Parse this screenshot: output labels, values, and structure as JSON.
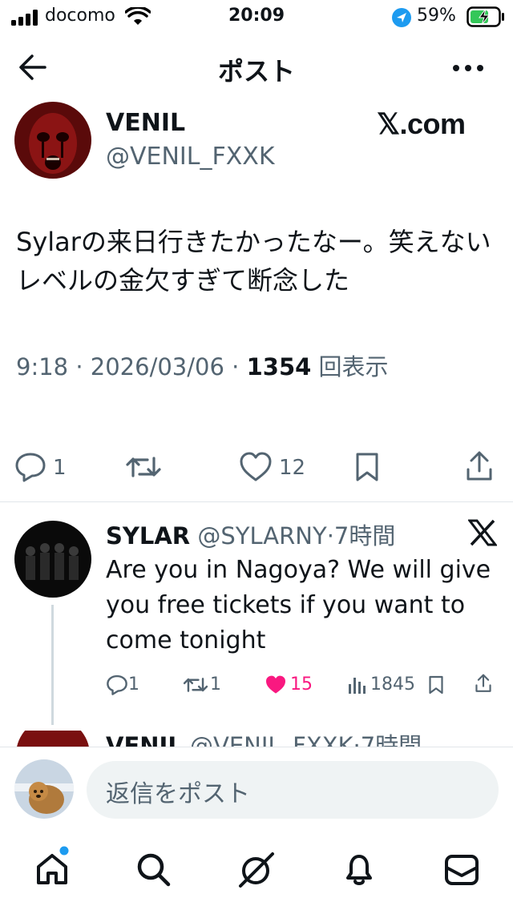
{
  "status_bar": {
    "carrier": "docomo",
    "time": "20:09",
    "battery": "59%"
  },
  "header": {
    "title": "ポスト"
  },
  "post": {
    "author_name": "VENIL",
    "author_handle": "@VENIL_FXXK",
    "brand": "𝕏.com",
    "text": "Sylarの来日行きたかったなー。笑えないレベルの金欠すぎて断念した",
    "time": "9:18",
    "date": "2026/03/06",
    "views": "1354",
    "views_label": "回表示",
    "replies": "1",
    "reposts": "",
    "likes": "12"
  },
  "reply": {
    "author_name": "SYLAR",
    "author_handle": "@SYLARNY",
    "age": "7時間",
    "text": "Are you in Nagoya? We will give you free tickets if you want to come tonight",
    "replies": "1",
    "reposts": "1",
    "likes": "15",
    "views": "1845"
  },
  "next_reply": {
    "author_name": "VENIL",
    "author_handle": "@VENIL_FXXK",
    "age": "7時間"
  },
  "composer": {
    "placeholder": "返信をポスト"
  },
  "colors": {
    "accent": "#1d9bf0",
    "like": "#f91880",
    "text": "#0f1419",
    "secondary": "#536471"
  }
}
